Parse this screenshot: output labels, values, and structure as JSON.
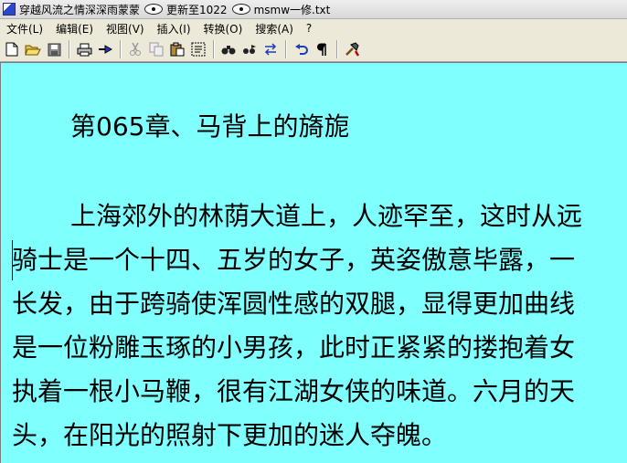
{
  "window": {
    "title_part1": "穿越风流之情深深雨蒙蒙",
    "title_part2": "更新至1022",
    "title_part3": "msmw一修.txt"
  },
  "menu": [
    {
      "label": "文件(L)"
    },
    {
      "label": "编辑(E)"
    },
    {
      "label": "视图(V)"
    },
    {
      "label": "插入(I)"
    },
    {
      "label": "转换(O)"
    },
    {
      "label": "搜索(A)"
    },
    {
      "label": "?"
    }
  ],
  "toolbar": {
    "icons": [
      "new-file-icon",
      "open-folder-icon",
      "save-icon",
      "print-icon",
      "pin-icon",
      "cut-icon",
      "copy-icon",
      "paste-icon",
      "select-all-icon",
      "find-icon",
      "find-next-icon",
      "replace-icon",
      "undo-icon",
      "paragraph-icon",
      "tools-icon"
    ]
  },
  "document": {
    "chapter_title": "第065章、马背上的旖旎",
    "lines": [
      "上海郊外的林荫大道上，人迹罕至，这时从远",
      "骑士是一个十四、五岁的女子，英姿傲意毕露，一",
      "长发，由于跨骑使浑圆性感的双腿，显得更加曲线",
      "是一位粉雕玉琢的小男孩，此时正紧紧的搂抱着女",
      "执着一根小马鞭，很有江湖女侠的味道。六月的天",
      "头，在阳光的照射下更加的迷人夺魄。"
    ]
  },
  "colors": {
    "editor_background": "#80ffff",
    "text": "#000000"
  }
}
